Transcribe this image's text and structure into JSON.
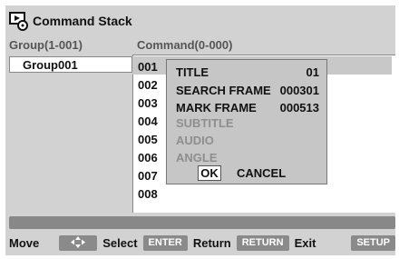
{
  "window": {
    "title": "Command Stack",
    "icon": "command-stack-icon"
  },
  "group_column": {
    "header": "Group(1-001)",
    "items": [
      {
        "label": "Group001"
      }
    ]
  },
  "command_column": {
    "header": "Command(0-000)",
    "items": [
      {
        "label": "001",
        "selected": true
      },
      {
        "label": "002"
      },
      {
        "label": "003"
      },
      {
        "label": "004"
      },
      {
        "label": "005"
      },
      {
        "label": "006"
      },
      {
        "label": "007"
      },
      {
        "label": "008"
      }
    ]
  },
  "popup": {
    "rows": [
      {
        "label": "TITLE",
        "value": "01",
        "enabled": true
      },
      {
        "label": "SEARCH FRAME",
        "value": "000301",
        "enabled": true
      },
      {
        "label": "MARK FRAME",
        "value": "000513",
        "enabled": true
      },
      {
        "label": "SUBTITLE",
        "value": "",
        "enabled": false
      },
      {
        "label": "AUDIO",
        "value": "",
        "enabled": false
      },
      {
        "label": "ANGLE",
        "value": "",
        "enabled": false
      }
    ],
    "ok_label": "OK",
    "cancel_label": "CANCEL"
  },
  "footer": {
    "move_label": "Move",
    "move_key_icon": "arrow-cross-icon",
    "select_label": "Select",
    "select_key": "ENTER",
    "return_label": "Return",
    "return_key": "RETURN",
    "exit_label": "Exit",
    "exit_key": "SETUP"
  },
  "colors": {
    "background": "#d2d2d2",
    "panel": "#ffffff",
    "popup": "#c6c6c6",
    "key": "#8a8a8a",
    "disabled_text": "#8e8e8e"
  }
}
